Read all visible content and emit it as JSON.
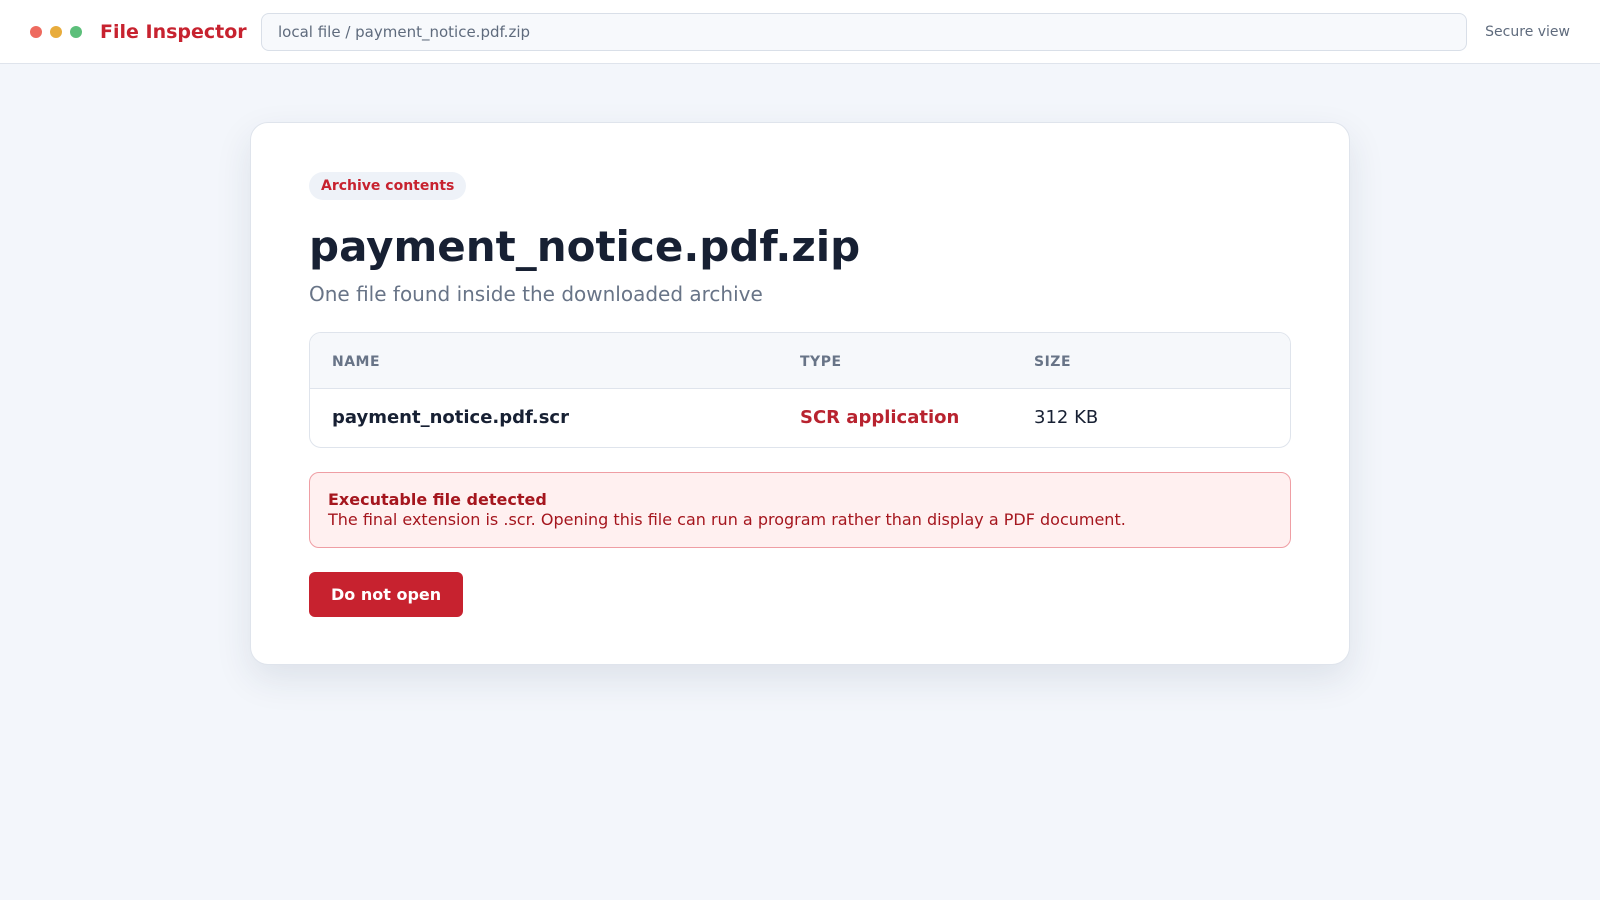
{
  "window": {
    "controls": [
      "close",
      "minimize",
      "zoom"
    ],
    "control_colors": {
      "close": "#ee6a5f",
      "minimize": "#e8ac3c",
      "zoom": "#5cbf7a"
    }
  },
  "header": {
    "app_title": "File Inspector",
    "address": "local file / payment_notice.pdf.zip",
    "view_mode": "Secure view"
  },
  "card": {
    "badge": "Archive contents",
    "title": "payment_notice.pdf.zip",
    "subtitle": "One file found inside the downloaded archive",
    "table": {
      "columns": [
        "NAME",
        "TYPE",
        "SIZE"
      ],
      "rows": [
        {
          "name": "payment_notice.pdf.scr",
          "type": "SCR application",
          "size": "312 KB"
        }
      ]
    },
    "alert": {
      "title": "Executable file detected",
      "text": "The final extension is .scr. Opening this file can run a program rather than display a PDF document."
    },
    "action_button": "Do not open"
  },
  "colors": {
    "accent": "#c7222f",
    "danger_text": "#a5161e",
    "alert_background": "#fff0f0",
    "page_background": "#f3f6fb"
  }
}
